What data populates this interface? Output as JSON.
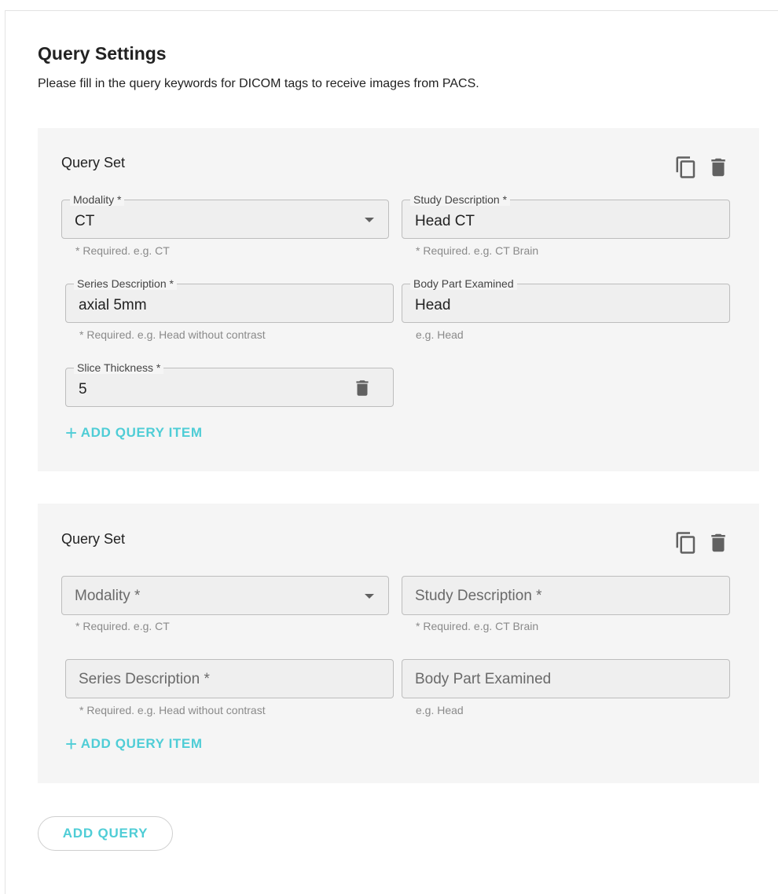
{
  "header": {
    "title": "Query Settings",
    "description": "Please fill in the query keywords for DICOM tags to receive images from PACS."
  },
  "query_sets": [
    {
      "title": "Query Set",
      "modality": {
        "label": "Modality *",
        "value": "CT",
        "helper": "* Required. e.g. CT"
      },
      "study_description": {
        "label": "Study Description *",
        "value": "Head CT",
        "helper": "* Required. e.g. CT Brain"
      },
      "series_description": {
        "label": "Series Description *",
        "value": "axial 5mm",
        "helper": "* Required. e.g. Head without contrast"
      },
      "body_part": {
        "label": "Body Part Examined",
        "value": "Head",
        "helper": "e.g. Head"
      },
      "slice_thickness": {
        "label": "Slice Thickness *",
        "value": "5"
      },
      "add_item_label": "ADD QUERY ITEM"
    },
    {
      "title": "Query Set",
      "modality": {
        "placeholder": "Modality *",
        "helper": "* Required. e.g. CT"
      },
      "study_description": {
        "placeholder": "Study Description *",
        "helper": "* Required. e.g. CT Brain"
      },
      "series_description": {
        "placeholder": "Series Description *",
        "helper": "* Required. e.g. Head without contrast"
      },
      "body_part": {
        "placeholder": "Body Part Examined",
        "helper": "e.g. Head"
      },
      "add_item_label": "ADD QUERY ITEM"
    }
  ],
  "add_query_label": "ADD QUERY",
  "icons": {
    "copy": "copy-icon",
    "delete": "trash-icon",
    "dropdown": "chevron-down-icon",
    "add": "plus-icon"
  },
  "colors": {
    "accent": "#4fcdd6",
    "panel_bg": "#f5f5f5",
    "field_bg": "#efefef",
    "icon_gray": "#616161"
  }
}
